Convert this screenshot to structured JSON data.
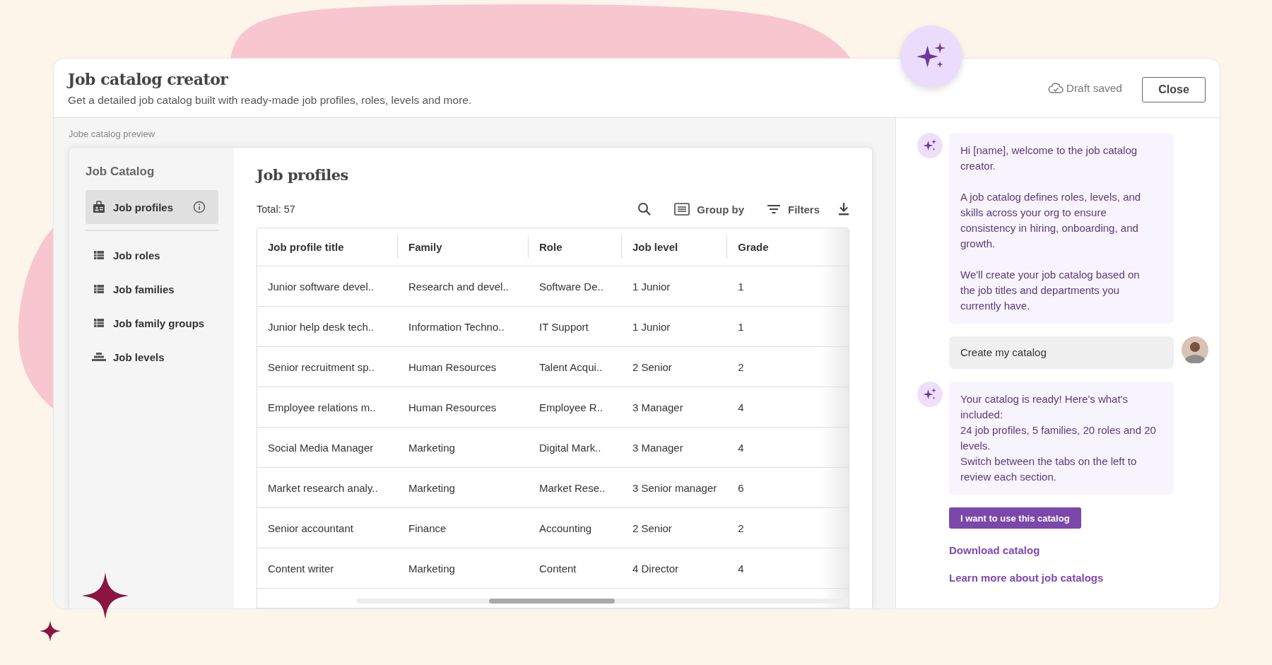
{
  "window": {
    "title": "Job catalog creator",
    "subtitle": "Get a detailed job catalog built with ready-made job profiles, roles, levels and more.",
    "draft_status": "Draft saved",
    "close_button": "Close"
  },
  "preview": {
    "label": "Jobe catalog preview",
    "sidebar": {
      "title": "Job Catalog",
      "items": [
        {
          "label": "Job profiles",
          "selected": true
        },
        {
          "label": "Job roles",
          "selected": false
        },
        {
          "label": "Job families",
          "selected": false
        },
        {
          "label": "Job family groups",
          "selected": false
        },
        {
          "label": "Job levels",
          "selected": false
        }
      ]
    },
    "main": {
      "title": "Job profiles",
      "total": "Total: 57",
      "toolbar": [
        "Group by",
        "Filters"
      ],
      "table": {
        "columns": [
          "Job profile title",
          "Family",
          "Role",
          "Job level",
          "Grade"
        ],
        "rows": [
          [
            "Junior software devel..",
            "Research and devel..",
            "Software De..",
            "1 Junior",
            "1"
          ],
          [
            "Junior help desk tech..",
            "Information Techno..",
            "IT Support",
            "1 Junior",
            "1"
          ],
          [
            "Senior recruitment sp..",
            "Human Resources",
            "Talent Acqui..",
            "2 Senior",
            "2"
          ],
          [
            "Employee relations m..",
            "Human Resources",
            "Employee R..",
            "3 Manager",
            "4"
          ],
          [
            "Social Media Manager",
            "Marketing",
            "Digital Mark..",
            "3 Manager",
            "4"
          ],
          [
            "Market research analy..",
            "Marketing",
            "Market Rese..",
            "3 Senior manager",
            "6"
          ],
          [
            "Senior accountant",
            "Finance",
            "Accounting",
            "2 Senior",
            "2"
          ],
          [
            "Content writer",
            "Marketing",
            "Content",
            "4 Director",
            "4"
          ]
        ]
      }
    }
  },
  "chat": {
    "messages": [
      {
        "kind": "bot",
        "text": "Hi [name], welcome to the job catalog creator.\n\nA job catalog defines roles, levels, and skills across your org to ensure consistency in hiring, onboarding, and growth.\n\nWe'll create your job catalog based on the job titles and departments you currently have."
      },
      {
        "kind": "user",
        "text": "Create my catalog"
      },
      {
        "kind": "bot",
        "text": "Your catalog is ready! Here's what's included:\n24 job profiles, 5 families, 20 roles and 20 levels.\nSwitch between the tabs on the left to review each section."
      }
    ],
    "primary_button": "I want to use this catalog",
    "links": [
      "Download catalog",
      "Learn more about job catalogs"
    ]
  }
}
